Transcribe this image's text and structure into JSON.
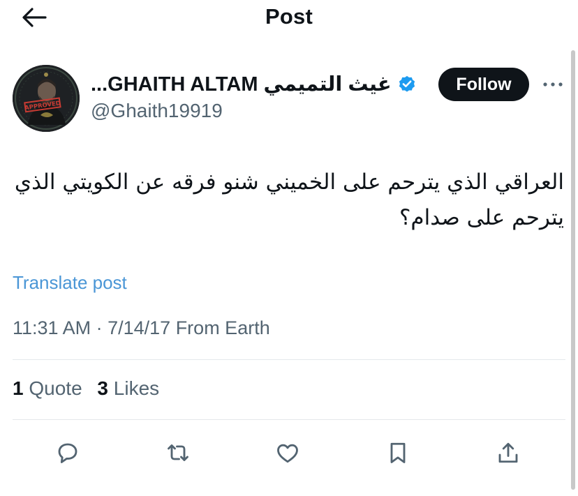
{
  "header": {
    "title": "Post",
    "back_icon": "arrow-left-icon"
  },
  "author": {
    "display_name": "غيث التميمي GHAITH ALTAM...",
    "handle": "@Ghaith19919",
    "verified_icon": "verified-badge-icon",
    "avatar_stamp_text": "APPROVED",
    "follow_label": "Follow",
    "more_icon": "more-horizontal-icon"
  },
  "tweet": {
    "text": "العراقي الذي يترحم على الخميني شنو فرقه عن الكويتي الذي يترحم على صدام؟",
    "translate_label": "Translate post",
    "time": "11:31 AM",
    "separator": "·",
    "date_source": "7/14/17 From Earth"
  },
  "stats": {
    "quotes_count": "1",
    "quotes_label": "Quote",
    "likes_count": "3",
    "likes_label": "Likes"
  },
  "actions": [
    "reply-icon",
    "repost-icon",
    "like-icon",
    "bookmark-icon",
    "share-icon"
  ],
  "colors": {
    "text_primary": "#0f1419",
    "text_secondary": "#536471",
    "link": "#4a96d6",
    "verified": "#1d9bf0",
    "follow_bg": "#0f1419",
    "divider": "#e4e8eb"
  }
}
